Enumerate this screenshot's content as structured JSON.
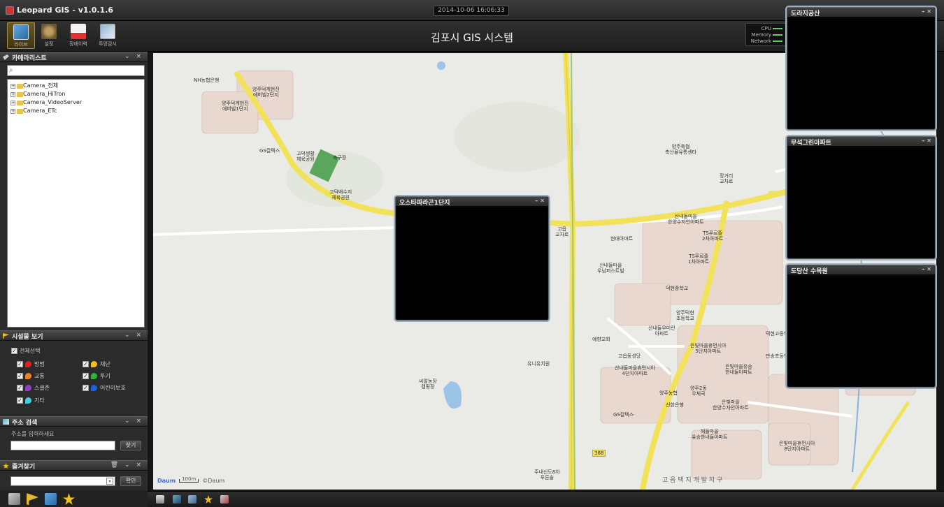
{
  "app": {
    "title": "Leopard GIS - v1.0.1.6",
    "datetime": "2014-10-06 16:06:33",
    "system_title": "김포시 GIS 시스템"
  },
  "toolbar": {
    "items": [
      {
        "label": "라이브",
        "icon": "live-icon",
        "active": true
      },
      {
        "label": "설정",
        "icon": "settings-icon",
        "active": false
      },
      {
        "label": "장애이력",
        "icon": "fault-history-icon",
        "active": false
      },
      {
        "label": "투망감시",
        "icon": "net-monitoring-icon",
        "active": false
      }
    ]
  },
  "sysmon": {
    "cpu": "CPU",
    "memory": "Memory",
    "network": "Network"
  },
  "camera_list": {
    "title": "카메라리스트",
    "tree": [
      "Camera_전체",
      "Camera_HiTron",
      "Camera_VideoServer",
      "Camera_ETc"
    ]
  },
  "facility": {
    "title": "시설물 보기",
    "select_all": "전체선택",
    "items": [
      {
        "label": "방범",
        "color": "#e02020"
      },
      {
        "label": "재난",
        "color": "#f0c020"
      },
      {
        "label": "교통",
        "color": "#f08020"
      },
      {
        "label": "투기",
        "color": "#30b040"
      },
      {
        "label": "스쿨존",
        "color": "#9040c0"
      },
      {
        "label": "어린이보호",
        "color": "#2060e0"
      },
      {
        "label": "기타",
        "color": "#40d0e0"
      }
    ]
  },
  "address": {
    "title": "주소 검색",
    "prompt": "주소를 입력하세요",
    "find_button": "찾기"
  },
  "favorites": {
    "title": "즐겨찾기",
    "confirm_button": "확인"
  },
  "map": {
    "labels": [
      "NH농협은행",
      "양주덕계현진\n에버빌2단지",
      "양주덕계현진\n에버빌1단지",
      "GS칼텍스",
      "고덕생활\n체육공원",
      "축구장",
      "고덕배수지\n체육공원",
      "양주축협\n축산물유통센타",
      "장거리\n교차로",
      "고읍\n교차로",
      "산내들마을\n한양수자인아파트",
      "TS푸르졸\n2차아파트",
      "현대아파트",
      "TS푸르졸\n1차아파트",
      "산내들마을\n우남퍼스트빌",
      "덕현중학교",
      "양주덕현\n초등학교",
      "산내들우미린\n아파트",
      "덕현고등학교",
      "예향교회",
      "은빛마을휴먼시아\n5단지아파트",
      "고읍동성당",
      "유니유치원",
      "산내들마을휴먼시아\n4단지아파트",
      "은빛마을유승\n한내들아파트",
      "만송초등학교",
      "씨알농장\n캠핑장",
      "양주농협",
      "양주2동\n우체국",
      "신한은행",
      "은빛마을\n한양수자인아파트",
      "GS칼텍스",
      "해들마을\n유승한내들아파트",
      "은빛마을휴먼시아\n8단지아파트",
      "주내신도8차\n푸른솔",
      "고 읍 택 지 개 발 지 구",
      "368"
    ],
    "attribution": "©Daum",
    "brand": "Daum",
    "scale": "100m"
  },
  "video_windows": [
    {
      "title": "오스타파라곤1단지"
    },
    {
      "title": "도라지공산"
    },
    {
      "title": "무석그린아파트"
    },
    {
      "title": "도당산 수목원"
    }
  ],
  "colors": {
    "accent": "#a08c44",
    "map_bg": "#eaeae6",
    "highway": "#f2e25a",
    "window_border": "#9ab0c4"
  }
}
